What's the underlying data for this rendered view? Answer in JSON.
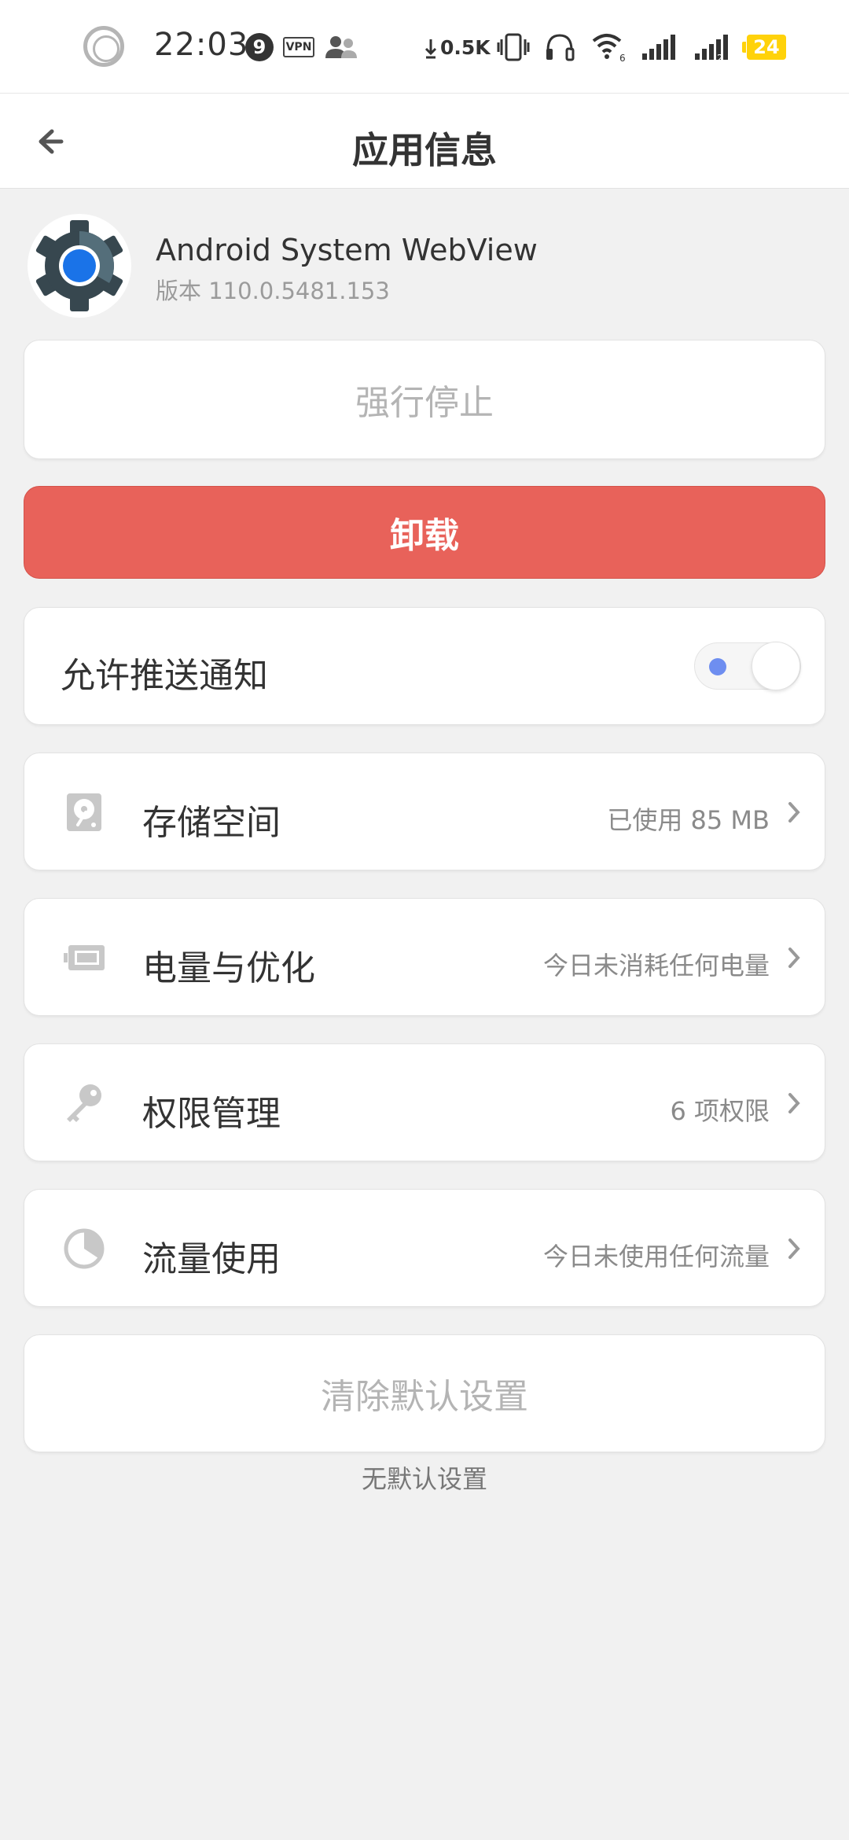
{
  "status_bar": {
    "time": "22:03",
    "notification_count": "9",
    "vpn_label": "VPN",
    "net_speed": "0.5K",
    "wifi_generation": "6",
    "sim2_label": "2",
    "battery": "24",
    "icons": [
      "record-ring-icon",
      "vpn-icon",
      "people-icon",
      "download-arrow-icon",
      "vibrate-icon",
      "headset-icon",
      "wifi-icon",
      "signal-icon",
      "signal-2-icon",
      "battery-icon"
    ]
  },
  "header": {
    "title": "应用信息",
    "back_icon": "back-arrow-icon"
  },
  "app": {
    "name": "Android System WebView",
    "version": "版本 110.0.5481.153",
    "icon": "webview-gear-icon"
  },
  "actions": {
    "force_stop": "强行停止",
    "uninstall": "卸载",
    "clear_defaults": "清除默认设置",
    "no_defaults_note": "无默认设置"
  },
  "notifications": {
    "label": "允许推送通知",
    "enabled": false
  },
  "settings": [
    {
      "icon": "storage-icon",
      "label": "存储空间",
      "value": "已使用 85 MB"
    },
    {
      "icon": "battery-icon",
      "label": "电量与优化",
      "value": "今日未消耗任何电量"
    },
    {
      "icon": "key-icon",
      "label": "权限管理",
      "value": "6 项权限"
    },
    {
      "icon": "data-usage-icon",
      "label": "流量使用",
      "value": "今日未使用任何流量"
    }
  ],
  "colors": {
    "uninstall": "#e8625a",
    "toggle_dot": "#6e8ef0",
    "battery_badge": "#ffd20a",
    "background": "#f1f1f1"
  }
}
